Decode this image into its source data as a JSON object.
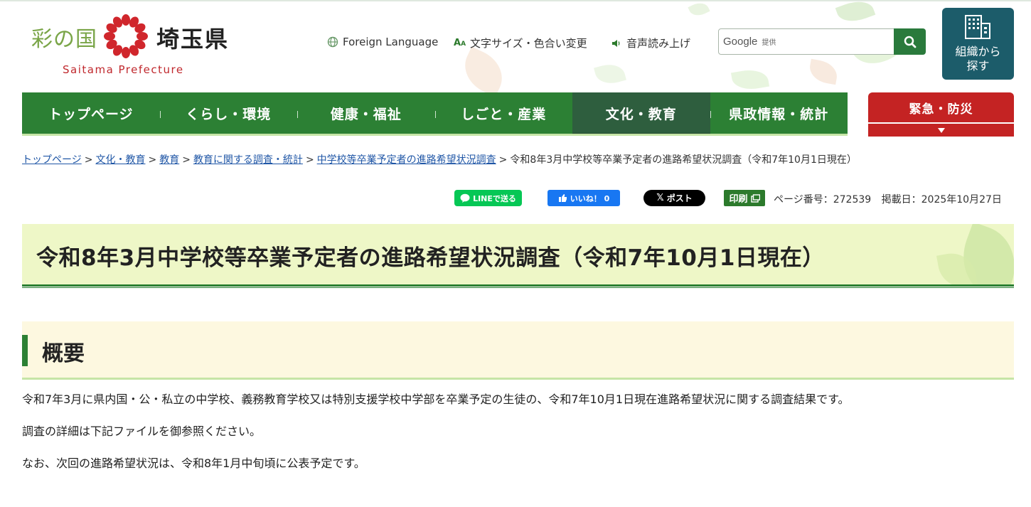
{
  "logo": {
    "jp_prefix": "彩の国",
    "jp_name": "埼玉県",
    "en": "Saitama Prefecture",
    "icon": "saitama-flower-icon"
  },
  "util": {
    "foreign": "Foreign Language",
    "text_size": "文字サイズ・色合い変更",
    "voice": "音声読み上げ"
  },
  "search": {
    "brand": "Google",
    "sub": "提供",
    "button_icon": "search-icon"
  },
  "org_button": {
    "line1": "組織から",
    "line2": "探す",
    "icon": "building-icon"
  },
  "nav": {
    "items": [
      {
        "label": "トップページ"
      },
      {
        "label": "くらし・環境"
      },
      {
        "label": "健康・福祉"
      },
      {
        "label": "しごと・産業"
      },
      {
        "label": "文化・教育"
      },
      {
        "label": "県政情報・統計"
      }
    ],
    "active": "文化・教育",
    "emergency": "緊急・防災"
  },
  "breadcrumb": {
    "links": [
      "トップページ",
      "文化・教育",
      "教育",
      "教育に関する調査・統計",
      "中学校等卒業予定者の進路希望状況調査"
    ],
    "current": "令和8年3月中学校等卒業予定者の進路希望状況調査（令和7年10月1日現在）",
    "separator": ">"
  },
  "share": {
    "line": "LINEで送る",
    "facebook": "いいね！ 0",
    "x": "ポスト",
    "print": "印刷"
  },
  "meta": {
    "page_number": "ページ番号：272539",
    "posted": "掲載日：2025年10月27日"
  },
  "page_title": "令和8年3月中学校等卒業予定者の進路希望状況調査（令和7年10月1日現在）",
  "section": {
    "heading": "概要",
    "paragraphs": [
      "令和7年3月に県内国・公・私立の中学校、義務教育学校又は特別支援学校中学部を卒業予定の生徒の、令和7年10月1日現在進路希望状況に関する調査結果です。",
      "調査の詳細は下記ファイルを御参照ください。",
      "なお、次回の進路希望状況は、令和8年1月中旬頃に公表予定です。"
    ]
  },
  "colors": {
    "nav_green": "#2c8034",
    "nav_active": "#2e5e3e",
    "emergency_red": "#c42323",
    "title_bg": "#eef7c7",
    "section_bg": "#fdf8e0",
    "link_blue": "#1f56a6",
    "org_teal": "#1c5c6a"
  }
}
